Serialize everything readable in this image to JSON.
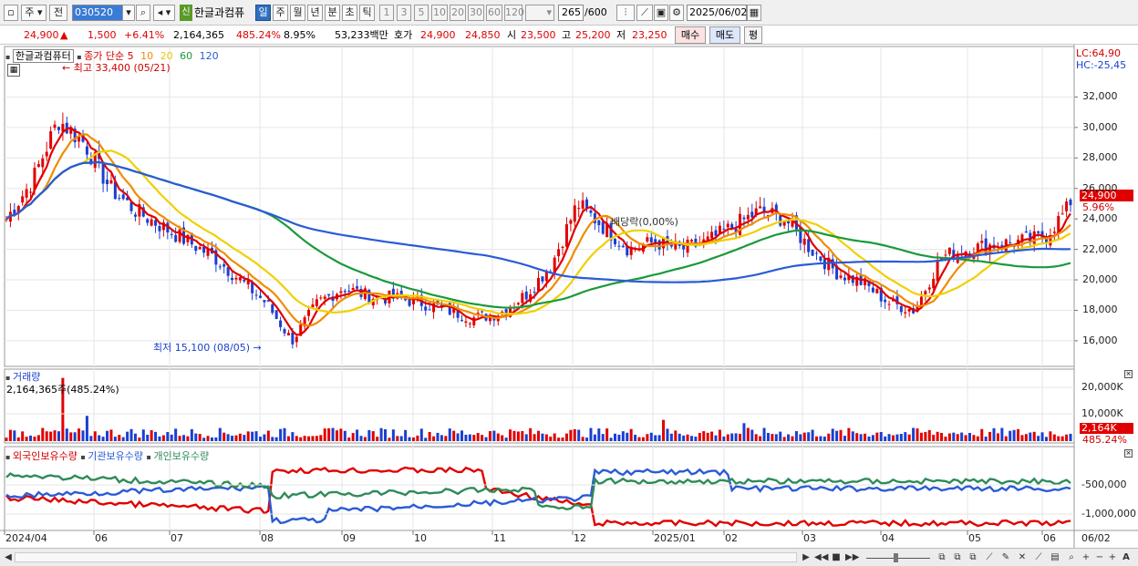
{
  "toolbar": {
    "type_label": "주",
    "prev_label": "전",
    "stock_code": "030520",
    "new_badge": "신",
    "stock_name": "한글과컴퓨",
    "period_tabs": [
      "일",
      "주",
      "월",
      "년",
      "분",
      "초",
      "틱"
    ],
    "minute_options": [
      "1",
      "3",
      "5",
      "10",
      "20",
      "30",
      "60",
      "120"
    ],
    "count_value": "265",
    "count_total": "/600",
    "date_value": "2025/06/02"
  },
  "quote": {
    "price": "24,900",
    "change_arrow": "▲",
    "change": "1,500",
    "change_rate": "+6.41%",
    "volume": "2,164,365",
    "volume_rate": "485.24%",
    "turnover": "8.95%",
    "amount": "53,233백만",
    "hoga_label": "호가",
    "ask": "24,900",
    "bid": "24,850",
    "open_label": "시",
    "open": "23,500",
    "high_label": "고",
    "high": "25,200",
    "low_label": "저",
    "low": "23,250",
    "buy_label": "매수",
    "sell_label": "매도",
    "eval_label": "평"
  },
  "chart": {
    "price_legend_name": "한글과컴퓨터",
    "ma_legend_prefix": "종가 단순",
    "ma_periods": [
      "5",
      "10",
      "20",
      "60",
      "120"
    ],
    "ma_colors": [
      "#e00000",
      "#f08c00",
      "#f0d000",
      "#1a9a3a",
      "#2a5bd7"
    ],
    "high_annot": "최고 33,400 (05/21)",
    "low_annot": "최저 15,100 (08/05)",
    "dividend_annot": "배당락(0,00%)",
    "lc_label": "LC:64,90",
    "hc_label": "HC:-25,45",
    "price_ticks": [
      "32,000",
      "30,000",
      "28,000",
      "26,000",
      "24,000",
      "22,000",
      "20,000",
      "18,000",
      "16,000"
    ],
    "current_price_tag": "24,900",
    "current_change_tag": "5.96%",
    "volume_title": "거래량",
    "volume_value": "2,164,365주(485.24%)",
    "volume_ticks": [
      "20,000K",
      "10,000K"
    ],
    "volume_tag": "2,164K",
    "volume_rate_tag": "485.24%",
    "holding_legend": [
      "외국인보유수량",
      "기관보유수량",
      "개인보유수량"
    ],
    "holding_colors": [
      "#e00000",
      "#2a5bd7",
      "#2e8b57"
    ],
    "holding_ticks": [
      "-500,000",
      "-1,000,000"
    ],
    "date_ticks": [
      "2024/04",
      "06",
      "07",
      "08",
      "09",
      "10",
      "11",
      "12",
      "2025/01",
      "02",
      "03",
      "04",
      "05",
      "06"
    ],
    "date_tail": "06/02"
  },
  "chart_data": {
    "type": "candlestick",
    "x_unit": "day",
    "y_range": [
      14800,
      33400
    ],
    "high": {
      "value": 33400,
      "date": "05/21"
    },
    "low": {
      "value": 15100,
      "date": "08/05"
    },
    "close_path": [
      24000,
      26500,
      30500,
      29000,
      26000,
      24500,
      23500,
      22500,
      21500,
      20000,
      18500,
      16000,
      18500,
      19500,
      18900,
      18800,
      18500,
      18000,
      17500,
      17800,
      19000,
      21000,
      25000,
      23500,
      22000,
      22500,
      22000,
      22500,
      23500,
      24500,
      24000,
      22000,
      20500,
      19800,
      18500,
      18000,
      21500,
      22000,
      22300,
      22500,
      22800,
      24900
    ]
  }
}
